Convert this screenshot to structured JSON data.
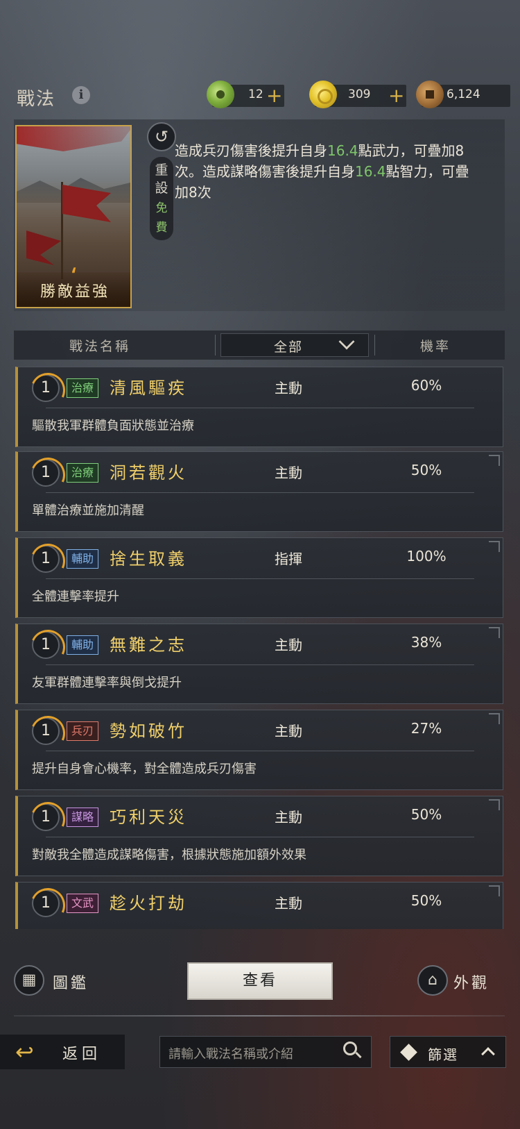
{
  "header": {
    "title": "戰法",
    "currencies": [
      {
        "icon": "jade-coin-icon",
        "value": "12"
      },
      {
        "icon": "gold-coin-icon",
        "value": "309"
      },
      {
        "icon": "copper-coin-icon",
        "value": "6,124"
      }
    ]
  },
  "card": {
    "name": "勝敵益強",
    "reset_label": "重設",
    "reset_cost": "免費"
  },
  "description": {
    "part1": "造成兵刃傷害後提升自身",
    "value1": "16.4",
    "part2": "點武力，可疊加8次。造成謀略傷害後提升自身",
    "value2": "16.4",
    "part3": "點智力，可疊加8次"
  },
  "filter": {
    "col_name": "戰法名稱",
    "dropdown_value": "全部",
    "col_rate": "機率"
  },
  "items": [
    {
      "level": "1",
      "tag": "治療",
      "name": "清風驅疾",
      "type": "主動",
      "rate": "60%",
      "desc": "驅散我軍群體負面狀態並治療"
    },
    {
      "level": "1",
      "tag": "治療",
      "name": "洞若觀火",
      "type": "主動",
      "rate": "50%",
      "desc": "單體治療並施加清醒"
    },
    {
      "level": "1",
      "tag": "輔助",
      "name": "捨生取義",
      "type": "指揮",
      "rate": "100%",
      "desc": "全體連擊率提升"
    },
    {
      "level": "1",
      "tag": "輔助",
      "name": "無難之志",
      "type": "主動",
      "rate": "38%",
      "desc": "友軍群體連擊率與倒戈提升"
    },
    {
      "level": "1",
      "tag": "兵刃",
      "name": "勢如破竹",
      "type": "主動",
      "rate": "27%",
      "desc": "提升自身會心機率，對全體造成兵刃傷害"
    },
    {
      "level": "1",
      "tag": "謀略",
      "name": "巧利天災",
      "type": "主動",
      "rate": "50%",
      "desc": "對敵我全體造成謀略傷害，根據狀態施加額外效果"
    },
    {
      "level": "1",
      "tag": "文武",
      "name": "趁火打劫",
      "type": "主動",
      "rate": "50%",
      "desc": ""
    }
  ],
  "bottom": {
    "left_label": "圖鑑",
    "view_label": "查看",
    "right_label": "外觀"
  },
  "footer": {
    "back_label": "返回",
    "search_placeholder": "請輸入戰法名稱或介紹",
    "filter_label": "篩選"
  }
}
